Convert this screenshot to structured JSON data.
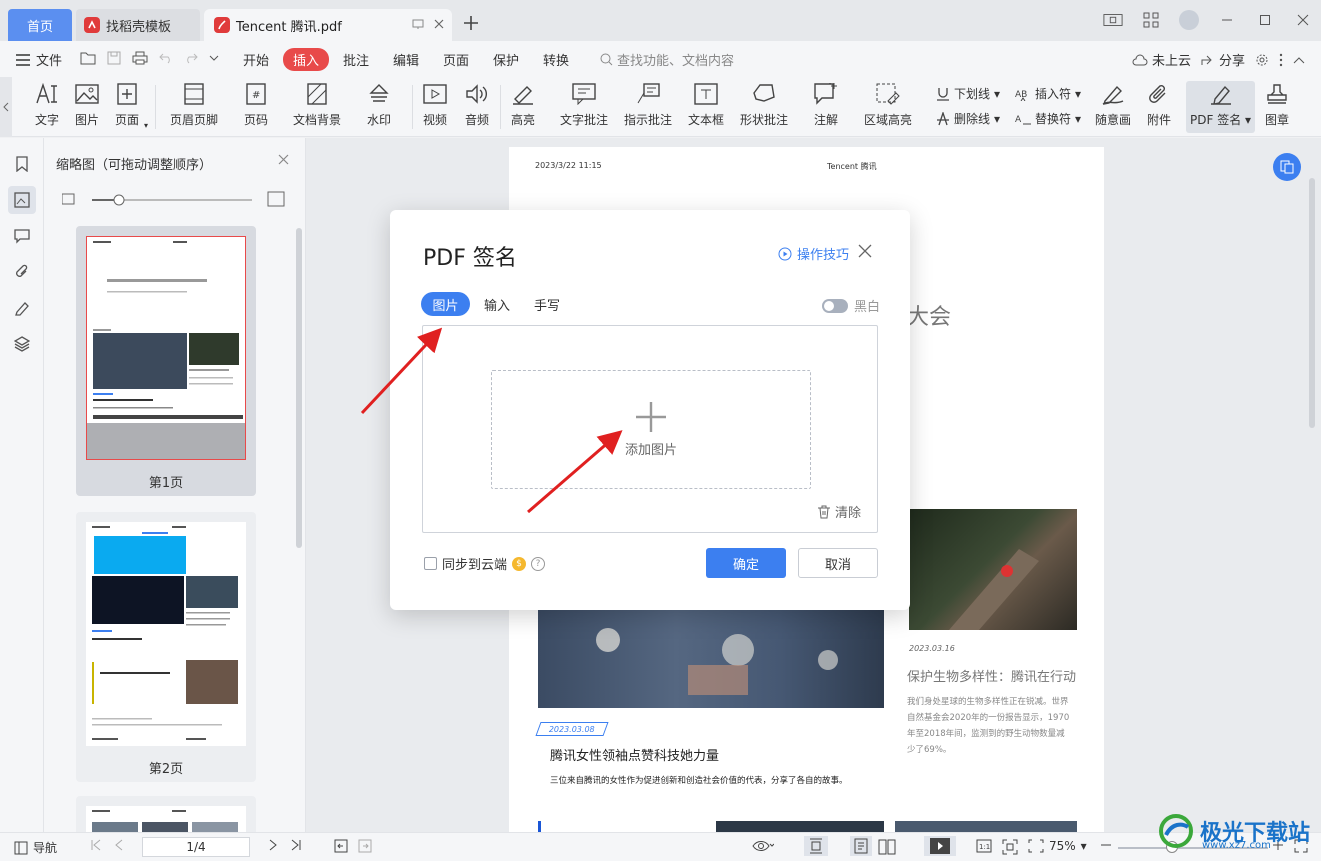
{
  "tabs": {
    "home": "首页",
    "template": "找稻壳模板",
    "pdf": "Tencent 腾讯.pdf"
  },
  "menu": {
    "file": "文件",
    "items": [
      "开始",
      "插入",
      "批注",
      "编辑",
      "页面",
      "保护",
      "转换"
    ],
    "search_placeholder": "查找功能、文档内容",
    "cloud": "未上云",
    "share": "分享"
  },
  "ribbon": {
    "text": "文字",
    "image": "图片",
    "page": "页面",
    "header_footer": "页眉页脚",
    "page_number": "页码",
    "background": "文档背景",
    "watermark": "水印",
    "video": "视频",
    "audio": "音频",
    "highlight": "高亮",
    "text_comment": "文字批注",
    "pointer_comment": "指示批注",
    "textbox": "文本框",
    "shape_comment": "形状批注",
    "annotation": "注解",
    "area_highlight": "区域高亮",
    "underline": "下划线",
    "strikethrough": "删除线",
    "insert_char": "插入符",
    "replace_char": "替换符",
    "freehand": "随意画",
    "attachment": "附件",
    "pdf_sign": "PDF 签名",
    "stamp": "图章"
  },
  "thumbs": {
    "title": "缩略图（可拖动调整顺序）",
    "page1": "第1页",
    "page2": "第2页"
  },
  "doc": {
    "header_date": "2023/3/22 11:15",
    "header_title": "Tencent 腾讯",
    "title_fragment": "大会",
    "date1": "2023.03.08",
    "article1_title": "腾讯女性领袖点赞科技她力量",
    "article1_sub": "三位来自腾讯的女性作为促进创新和创造社会价值的代表，分享了各自的故事。",
    "date2": "2023.03.16",
    "article2_title": "保护生物多样性：腾讯在行动",
    "article2_body": "我们身处星球的生物多样性正在锐减。世界自然基金会2020年的一份报告显示，1970年至2018年间，监测到的野生动物数量减少了69%。"
  },
  "dialog": {
    "title": "PDF 签名",
    "tips": "操作技巧",
    "tab_image": "图片",
    "tab_input": "输入",
    "tab_handwrite": "手写",
    "bw": "黑白",
    "add_image": "添加图片",
    "clear": "清除",
    "sync": "同步到云端",
    "ok": "确定",
    "cancel": "取消"
  },
  "status": {
    "nav": "导航",
    "page": "1/4",
    "zoom": "75%"
  },
  "watermark": {
    "text": "极光下载站",
    "url": "www.xz7.com"
  },
  "colors": {
    "accent": "#3c7ff0",
    "insert_tab": "#e84a4a",
    "arrow": "#e02020"
  }
}
